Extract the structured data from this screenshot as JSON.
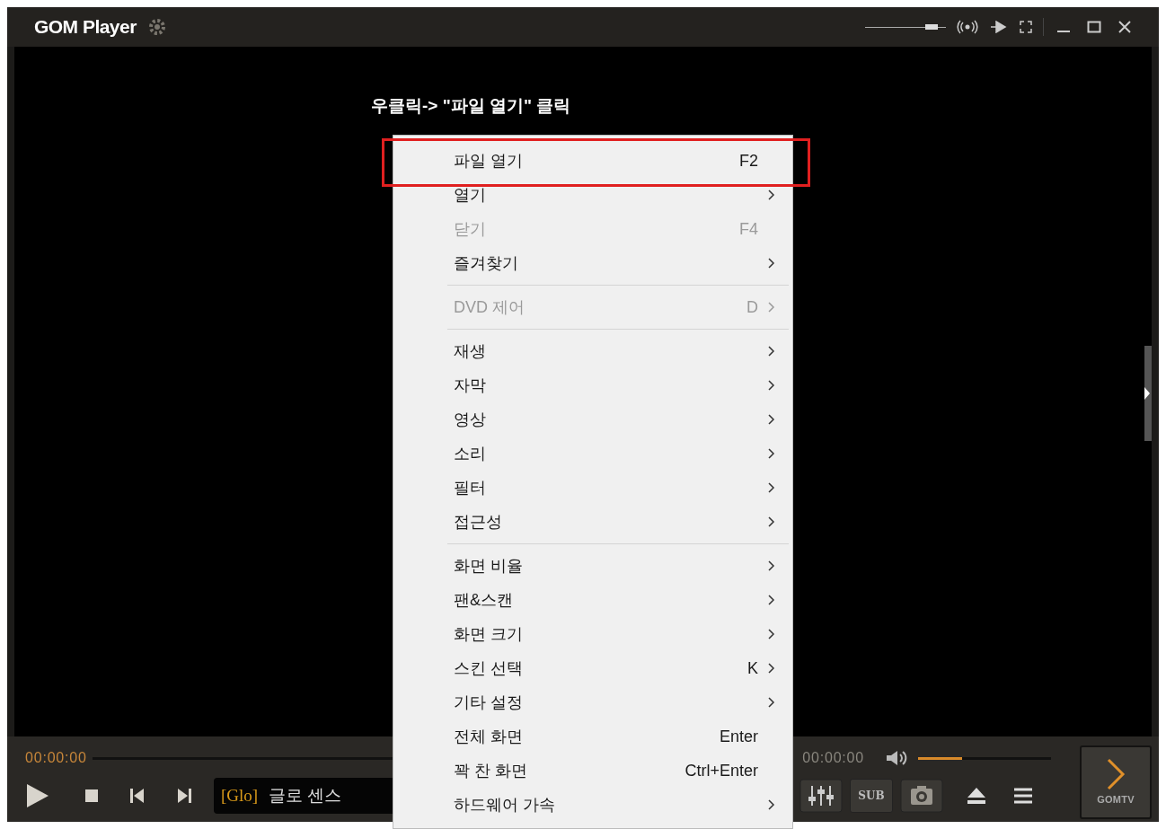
{
  "window": {
    "title": "GOM Player",
    "opacity": {
      "level": 0.88
    }
  },
  "annotation": {
    "text": "우클릭-> \"파일 열기\" 클릭"
  },
  "context_menu": [
    {
      "kind": "item",
      "label": "파일 열기",
      "shortcut": "F2",
      "submenu": false,
      "disabled": false,
      "annotated": true
    },
    {
      "kind": "item",
      "label": "열기",
      "submenu": true,
      "disabled": false,
      "annotated": false
    },
    {
      "kind": "item",
      "label": "닫기",
      "shortcut": "F4",
      "submenu": false,
      "disabled": true,
      "annotated": false
    },
    {
      "kind": "item",
      "label": "즐겨찾기",
      "submenu": true,
      "disabled": false,
      "annotated": false
    },
    {
      "kind": "separator"
    },
    {
      "kind": "item",
      "label": "DVD 제어",
      "shortcut": "D",
      "submenu": true,
      "disabled": true,
      "annotated": false
    },
    {
      "kind": "separator"
    },
    {
      "kind": "item",
      "label": "재생",
      "submenu": true,
      "disabled": false,
      "annotated": false
    },
    {
      "kind": "item",
      "label": "자막",
      "submenu": true,
      "disabled": false,
      "annotated": false
    },
    {
      "kind": "item",
      "label": "영상",
      "submenu": true,
      "disabled": false,
      "annotated": false
    },
    {
      "kind": "item",
      "label": "소리",
      "submenu": true,
      "disabled": false,
      "annotated": false
    },
    {
      "kind": "item",
      "label": "필터",
      "submenu": true,
      "disabled": false,
      "annotated": false
    },
    {
      "kind": "item",
      "label": "접근성",
      "submenu": true,
      "disabled": false,
      "annotated": false
    },
    {
      "kind": "separator"
    },
    {
      "kind": "item",
      "label": "화면 비율",
      "submenu": true,
      "disabled": false,
      "annotated": false
    },
    {
      "kind": "item",
      "label": "팬&스캔",
      "submenu": true,
      "disabled": false,
      "annotated": false
    },
    {
      "kind": "item",
      "label": "화면 크기",
      "submenu": true,
      "disabled": false,
      "annotated": false
    },
    {
      "kind": "item",
      "label": "스킨 선택",
      "shortcut": "K",
      "submenu": true,
      "disabled": false,
      "annotated": false
    },
    {
      "kind": "item",
      "label": "기타 설정",
      "submenu": true,
      "disabled": false,
      "annotated": false
    },
    {
      "kind": "item",
      "label": "전체 화면",
      "shortcut": "Enter",
      "submenu": false,
      "disabled": false,
      "annotated": false
    },
    {
      "kind": "item",
      "label": "꽉 찬 화면",
      "shortcut": "Ctrl+Enter",
      "submenu": false,
      "disabled": false,
      "annotated": false
    },
    {
      "kind": "item",
      "label": "하드웨어 가속",
      "submenu": true,
      "disabled": false,
      "annotated": false
    }
  ],
  "controls": {
    "elapsed": "00:00:00",
    "playlist_tag": "[Glo]",
    "playlist_title": "글로 센스",
    "total": "00:00:00",
    "volume": {
      "level": 0.33
    },
    "sub_button": "SUB",
    "brand_button": "GOMTV"
  }
}
